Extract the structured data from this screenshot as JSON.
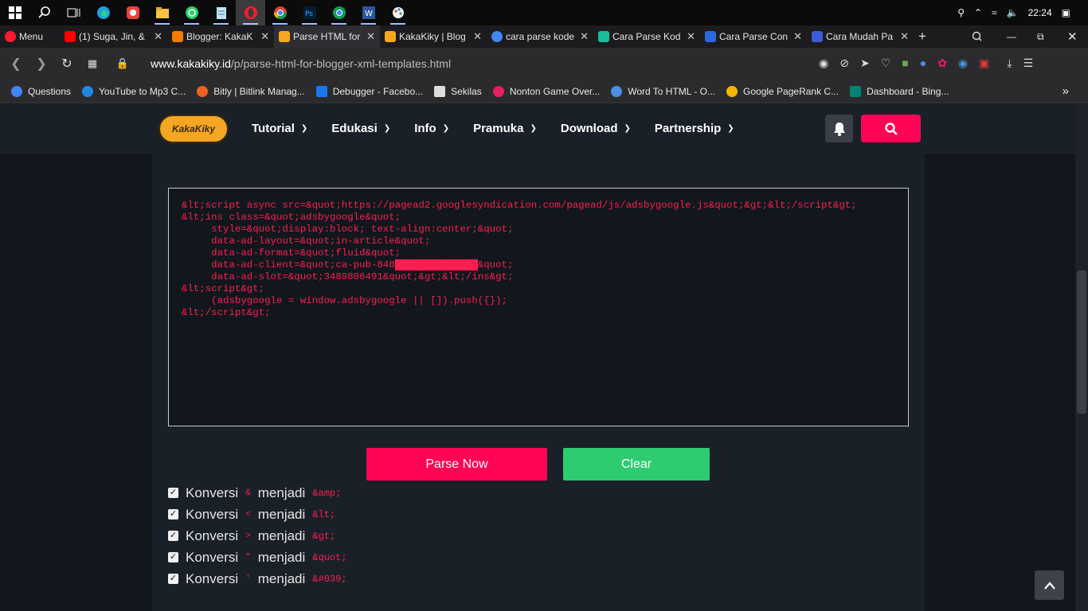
{
  "taskbar": {
    "time": "22:24",
    "icons": [
      "windows-start-icon",
      "search-icon",
      "task-view-icon",
      "edge-icon",
      "recorder-icon",
      "file-explorer-icon",
      "whatsapp-icon",
      "notepad-icon",
      "opera-icon",
      "chrome-icon",
      "photoshop-icon",
      "chrome-alt-icon",
      "word-icon",
      "paint-icon"
    ]
  },
  "browser": {
    "menu_label": "Menu",
    "tabs": [
      {
        "title": "(1) Suga, Jin, &",
        "color": "#ff0000"
      },
      {
        "title": "Blogger: KakaK",
        "color": "#f57d00"
      },
      {
        "title": "Parse HTML for",
        "color": "#f5a623"
      },
      {
        "title": "KakaKiky | Blog",
        "color": "#f5a623"
      },
      {
        "title": "cara parse kode",
        "color": "#4285f4"
      },
      {
        "title": "Cara Parse Kod",
        "color": "#1abc9c"
      },
      {
        "title": "Cara Parse Con",
        "color": "#2a6ad8"
      },
      {
        "title": "Cara Mudah Pa",
        "color": "#3b5bdb"
      }
    ],
    "url_host": "www.kakakiky.id",
    "url_path": "/p/parse-html-for-blogger-xml-templates.html",
    "bookmarks": [
      {
        "label": "Questions",
        "color": "#4285f4"
      },
      {
        "label": "YouTube to Mp3 C...",
        "color": "#1e88e5"
      },
      {
        "label": "Bitly | Bitlink Manag...",
        "color": "#ee6123"
      },
      {
        "label": "Debugger - Facebo...",
        "color": "#1877f2"
      },
      {
        "label": "Sekilas",
        "color": "#dddddd"
      },
      {
        "label": "Nonton Game Over...",
        "color": "#e91e63"
      },
      {
        "label": "Word To HTML - O...",
        "color": "#4a90e2"
      },
      {
        "label": "Google PageRank C...",
        "color": "#f4b400"
      },
      {
        "label": "Dashboard - Bing...",
        "color": "#008373"
      }
    ]
  },
  "site": {
    "logo_text": "KakaKiky",
    "menu": [
      "Tutorial",
      "Edukasi",
      "Info",
      "Pramuka",
      "Download",
      "Partnership"
    ]
  },
  "tool": {
    "code_lines": [
      "&lt;script async src=&quot;https://pagead2.googlesyndication.com/pagead/js/adsbygoogle.js&quot;&gt;&lt;/script&gt;",
      "&lt;ins class=&quot;adsbygoogle&quot;",
      "     style=&quot;display:block; text-align:center;&quot;",
      "     data-ad-layout=&quot;in-article&quot;",
      "     data-ad-format=&quot;fluid&quot;",
      "     data-ad-client=&quot;ca-pub-848",
      "&quot;",
      "     data-ad-slot=&quot;3489806491&quot;&gt;&lt;/ins&gt;",
      "&lt;script&gt;",
      "     (adsbygoogle = window.adsbygoogle || []).push({});",
      "&lt;/script&gt;"
    ],
    "parse_label": "Parse Now",
    "clear_label": "Clear",
    "options": [
      {
        "prefix": "Konversi",
        "symbol": "&",
        "middle": "menjadi",
        "entity": "&amp;",
        "checked": true
      },
      {
        "prefix": "Konversi",
        "symbol": "<",
        "middle": "menjadi",
        "entity": "&lt;",
        "checked": true
      },
      {
        "prefix": "Konversi",
        "symbol": ">",
        "middle": "menjadi",
        "entity": "&gt;",
        "checked": true
      },
      {
        "prefix": "Konversi",
        "symbol": "\"",
        "middle": "menjadi",
        "entity": "&quot;",
        "checked": true
      },
      {
        "prefix": "Konversi",
        "symbol": "'",
        "middle": "menjadi",
        "entity": "&#039;",
        "checked": true
      }
    ]
  }
}
